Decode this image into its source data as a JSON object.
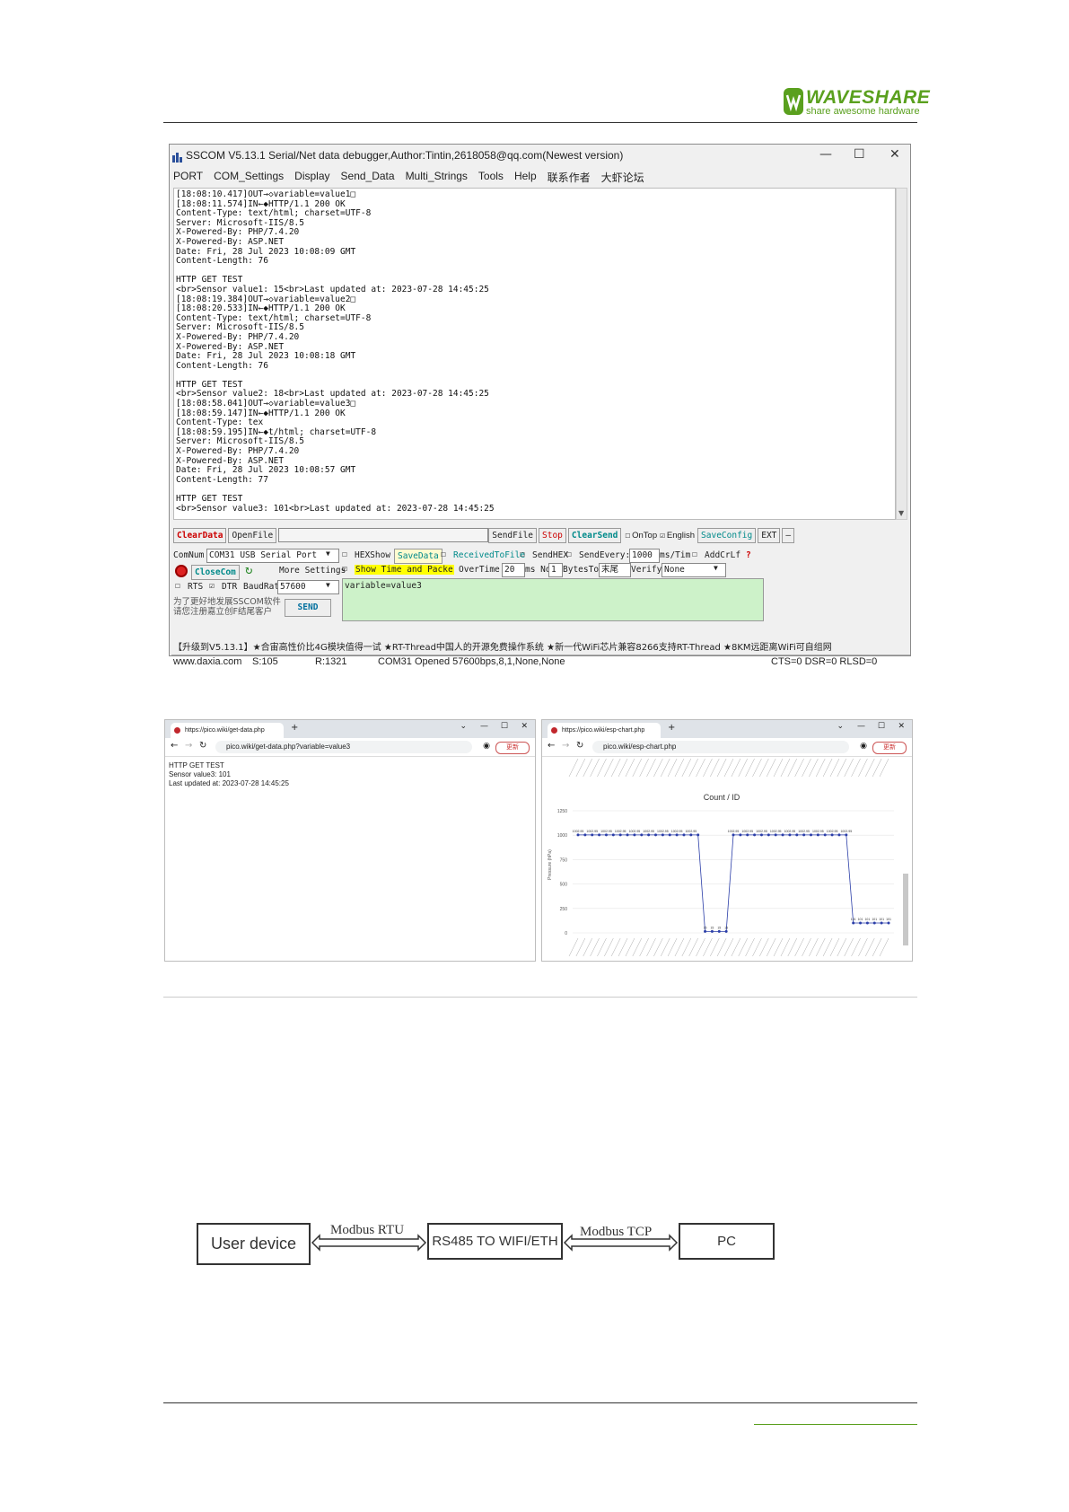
{
  "header": {
    "logo_text": "WAVESHARE",
    "logo_tagline": "share awesome hardware",
    "brand_color": "#5aa01e"
  },
  "sscom": {
    "title": "SSCOM V5.13.1 Serial/Net data debugger,Author:Tintin,2618058@qq.com(Newest version)",
    "menu": [
      "PORT",
      "COM_Settings",
      "Display",
      "Send_Data",
      "Multi_Strings",
      "Tools",
      "Help",
      "联系作者",
      "大虾论坛"
    ],
    "log": "[18:08:10.417]OUT→◇variable=value1□\n[18:08:11.574]IN←◆HTTP/1.1 200 OK\nContent-Type: text/html; charset=UTF-8\nServer: Microsoft-IIS/8.5\nX-Powered-By: PHP/7.4.20\nX-Powered-By: ASP.NET\nDate: Fri, 28 Jul 2023 10:08:09 GMT\nContent-Length: 76\n\nHTTP GET TEST\n<br>Sensor value1: 15<br>Last updated at: 2023-07-28 14:45:25\n[18:08:19.384]OUT→◇variable=value2□\n[18:08:20.533]IN←◆HTTP/1.1 200 OK\nContent-Type: text/html; charset=UTF-8\nServer: Microsoft-IIS/8.5\nX-Powered-By: PHP/7.4.20\nX-Powered-By: ASP.NET\nDate: Fri, 28 Jul 2023 10:08:18 GMT\nContent-Length: 76\n\nHTTP GET TEST\n<br>Sensor value2: 18<br>Last updated at: 2023-07-28 14:45:25\n[18:08:58.041]OUT→◇variable=value3□\n[18:08:59.147]IN←◆HTTP/1.1 200 OK\nContent-Type: tex\n[18:08:59.195]IN←◆t/html; charset=UTF-8\nServer: Microsoft-IIS/8.5\nX-Powered-By: PHP/7.4.20\nX-Powered-By: ASP.NET\nDate: Fri, 28 Jul 2023 10:08:57 GMT\nContent-Length: 77\n\nHTTP GET TEST\n<br>Sensor value3: 101<br>Last updated at: 2023-07-28 14:45:25",
    "toolbar": {
      "clear_data": "ClearData",
      "open_file": "OpenFile",
      "send_file": "SendFile",
      "stop": "Stop",
      "clear_send": "ClearSend",
      "on_top": "OnTop",
      "english": "English",
      "save_config": "SaveConfig",
      "ext": "EXT",
      "minus": "—"
    },
    "controls": {
      "com_num_label": "ComNum",
      "com_num_value": "COM31 USB Serial Port",
      "close_com": "CloseCom",
      "more_settings": "More Settings",
      "rts": "RTS",
      "dtr": "DTR",
      "baud_label": "BaudRat",
      "baud_value": "57600",
      "promo": "为了更好地发展SSCOM软件\n请您注册嘉立创F结尾客户",
      "send": "SEND",
      "hex_show": "HEXShow",
      "save_data": "SaveData",
      "received_to_file": "ReceivedToFile",
      "send_hex": "SendHEX",
      "send_every": "SendEvery:",
      "send_every_value": "1000",
      "send_every_unit": "ms/Tim",
      "add_crlf": "AddCrLf",
      "show_time": "Show Time and Packe",
      "over_time": "OverTime:",
      "over_time_value": "20",
      "ms_no": "ms No",
      "no_value": "1",
      "bytes_to": "BytesTo",
      "bytes_to_value": "末尾",
      "verify": "Verify",
      "verify_value": "None",
      "send_text": "variable=value3"
    },
    "ticker": "【升级到V5.13.1】★合宙高性价比4G模块值得一试 ★RT-Thread中国人的开源免费操作系统 ★新一代WiFi芯片兼容8266支持RT-Thread ★8KM远距离WiFi可自组网",
    "status": {
      "site": "www.daxia.com",
      "sent": "S:105",
      "received": "R:1321",
      "port_info": "COM31 Opened  57600bps,8,1,None,None",
      "lines": "CTS=0 DSR=0 RLSD=0"
    }
  },
  "browser_left": {
    "tab_title": "https://pico.wiki/get-data.php",
    "url": "pico.wiki/get-data.php?variable=value3",
    "update_button": "更新",
    "body_lines": [
      "HTTP GET TEST",
      "Sensor value3: 101",
      "Last updated at: 2023-07-28 14:45:25"
    ]
  },
  "browser_right": {
    "tab_title": "https://pico.wiki/esp-chart.php",
    "url": "pico.wiki/esp-chart.php",
    "update_button": "更新"
  },
  "chart_data": {
    "type": "line",
    "title": "Count / ID",
    "ylabel": "Pressure (hPa)",
    "ylim": [
      0,
      1250
    ],
    "yticks": [
      0,
      250,
      500,
      750,
      1000,
      1250
    ],
    "grid": true,
    "series": [
      {
        "color": "#2b3ea8",
        "values": [
          1002.95,
          1002.95,
          1002.95,
          1002.95,
          1002.95,
          1002.95,
          1002.95,
          1002.95,
          1002.95,
          1002.95,
          1002.95,
          1002.95,
          1002.95,
          1002.95,
          1002.95,
          1002.95,
          1002.95,
          1002.95,
          15,
          15,
          15,
          15,
          1002.95,
          1002.95,
          1002.95,
          1002.95,
          1002.95,
          1002.95,
          1002.95,
          1002.95,
          1002.95,
          1002.95,
          1002.95,
          1002.95,
          1002.95,
          1002.95,
          1002.95,
          1002.95,
          1002.95,
          101,
          101,
          101,
          101,
          101,
          101
        ]
      }
    ]
  },
  "diagram": {
    "nodes": [
      "User device",
      "RS485 TO WIFI/ETH",
      "PC"
    ],
    "edges": [
      "Modbus RTU",
      "Modbus TCP"
    ]
  }
}
